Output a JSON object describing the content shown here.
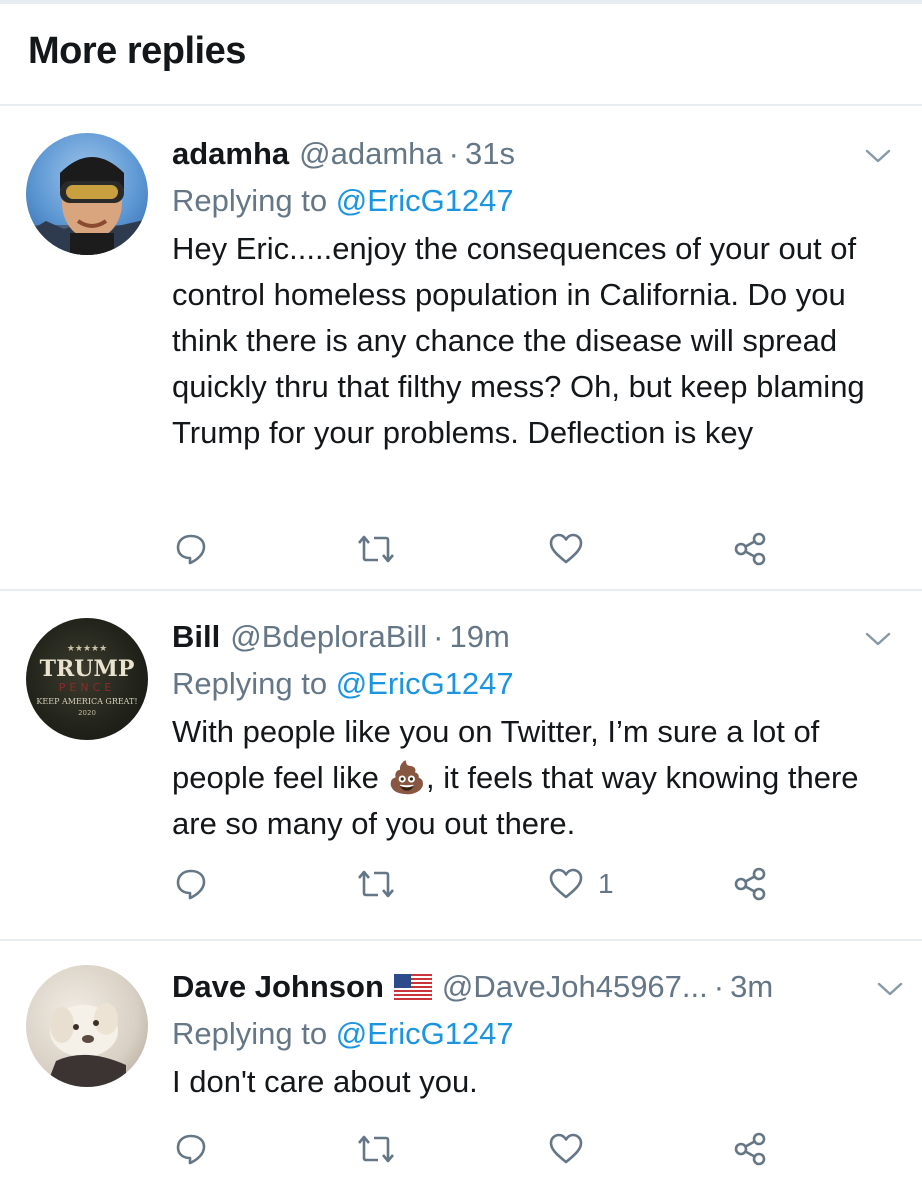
{
  "header": {
    "title": "More replies"
  },
  "replies": [
    {
      "name": "adamha",
      "handle": "@adamha",
      "separator": "·",
      "time": "31s",
      "replying_prefix": "Replying to ",
      "replying_to": "@EricG1247",
      "text": "Hey Eric.....enjoy the consequences of your out of control homeless population in California. Do you think there is any chance the disease will spread quickly thru that filthy mess? Oh, but keep blaming Trump for your problems. Deflection is key",
      "like_count": ""
    },
    {
      "name": "Bill",
      "handle": "@BdeploraBill",
      "separator": "·",
      "time": "19m",
      "replying_prefix": "Replying to ",
      "replying_to": "@EricG1247",
      "text_before_emoji": "With people like you on Twitter, I’m sure a lot of people feel like ",
      "emoji": "💩",
      "text_after_emoji": ", it feels that way knowing there are so many of you out there.",
      "like_count": "1",
      "avatar_text": {
        "stars": "★★★★★",
        "line1": "TRUMP",
        "line2": "PENCE",
        "line3": "KEEP AMERICA GREAT!",
        "line4": "2020"
      }
    },
    {
      "name": "Dave Johnson",
      "name_flag": "US flag",
      "handle": "@DaveJoh45967...",
      "separator": "·",
      "time": "3m",
      "replying_prefix": "Replying to ",
      "replying_to": "@EricG1247",
      "text": "I don't care about you.",
      "like_count": ""
    }
  ],
  "icons": [
    "reply-icon",
    "retweet-icon",
    "like-icon",
    "share-icon",
    "chevron-down-icon"
  ],
  "colors": {
    "link": "#1b95e0",
    "secondary": "#657786",
    "divider": "#e6ecf0",
    "text": "#14171a"
  }
}
